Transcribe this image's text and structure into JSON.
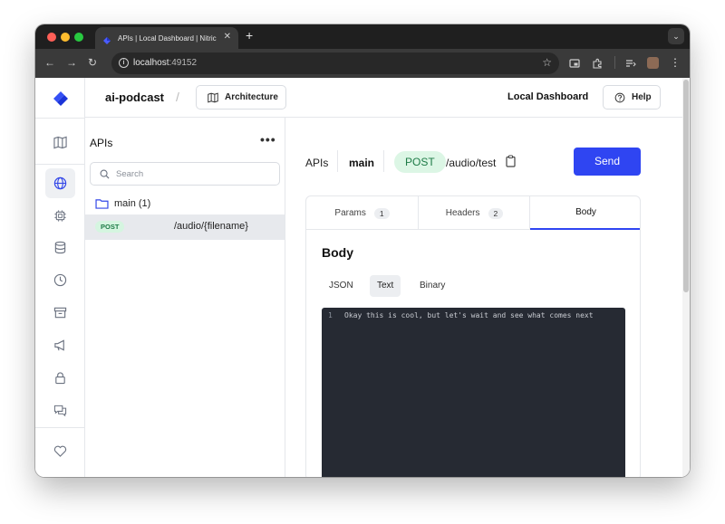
{
  "browser": {
    "tab_title": "APIs | Local Dashboard | Nitric",
    "tab_close": "✕",
    "new_tab": "+",
    "url_host": "localhost",
    "url_port": ":49152",
    "traffic_lights": [
      "#ff5f57",
      "#febc2e",
      "#28c840"
    ]
  },
  "header": {
    "project": "ai-podcast",
    "separator": "/",
    "architecture_label": "Architecture",
    "dashboard_title": "Local Dashboard",
    "help_label": "Help"
  },
  "rail": {
    "items": [
      "map-icon",
      "globe-icon",
      "cpu-icon",
      "database-icon",
      "clock-icon",
      "archive-icon",
      "megaphone-icon",
      "lock-icon",
      "chat-icon",
      "heart-icon"
    ],
    "active": "globe-icon"
  },
  "sidebar": {
    "title": "APIs",
    "more": "•••",
    "search_placeholder": "Search",
    "folder_label": "main (1)",
    "routes": [
      {
        "method": "POST",
        "path": "/audio/{filename}"
      }
    ]
  },
  "request": {
    "apis_label": "APIs",
    "branch": "main",
    "method": "POST",
    "path": "/audio/test",
    "send_label": "Send"
  },
  "panel": {
    "tabs": [
      {
        "label": "Params",
        "count": "1"
      },
      {
        "label": "Headers",
        "count": "2"
      },
      {
        "label": "Body",
        "count": ""
      }
    ],
    "active_tab": "Body",
    "body_title": "Body",
    "formats": [
      "JSON",
      "Text",
      "Binary"
    ],
    "active_format": "Text",
    "editor": {
      "line_number": "1",
      "content": "Okay this is cool, but let's wait and see what comes next"
    }
  },
  "colors": {
    "accent": "#2f45f2",
    "post_green": "#1e7b47",
    "post_bg": "#dcf6e5",
    "editor_bg": "#262a33"
  }
}
